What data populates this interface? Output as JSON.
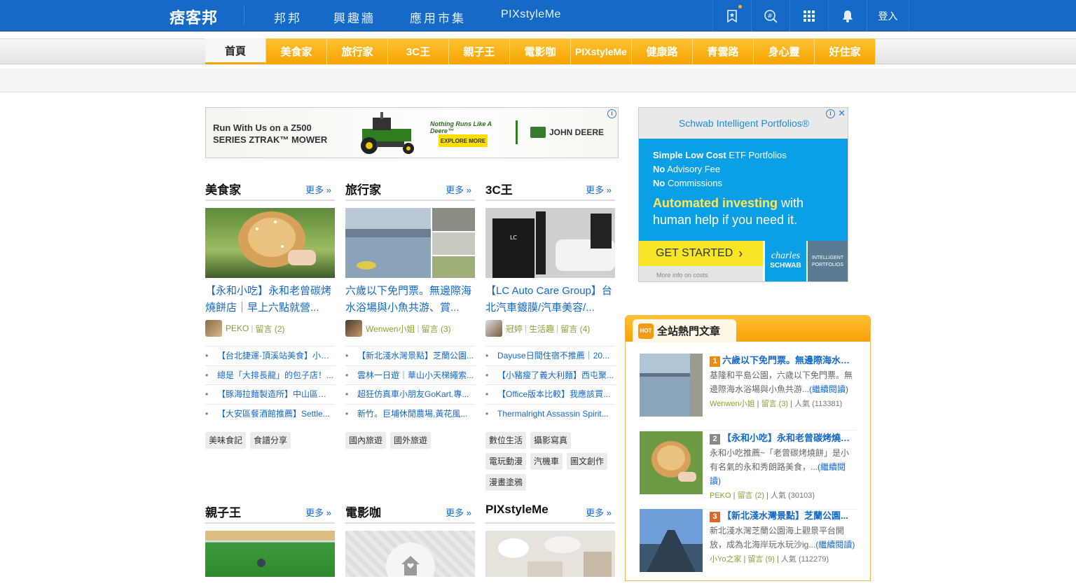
{
  "topbar": {
    "logo": "痞客邦",
    "nav": [
      "邦邦",
      "興趣牆",
      "應用市集",
      "PIXstyleMe"
    ],
    "icons": [
      "bookmark-star-icon",
      "search-hash-icon",
      "apps-grid-icon",
      "bell-icon"
    ],
    "login": "登入"
  },
  "categories": [
    "首頁",
    "美食家",
    "旅行家",
    "3C王",
    "親子王",
    "電影咖",
    "PIXstyleMe",
    "健康路",
    "青雲路",
    "身心靈",
    "好住家"
  ],
  "ad_banner": {
    "headline": "Run With Us on a Z500 SERIES ZTRAK™ MOWER",
    "tagline": "Nothing Runs Like A Deere™",
    "button": "EXPLORE MORE",
    "brand": "JOHN DEERE"
  },
  "ad_side": {
    "title": "Schwab Intelligent Portfolios®",
    "lines": [
      {
        "bold": "Simple Low Cost",
        "rest": " ETF Portfolios"
      },
      {
        "bold": "No",
        "rest": " Advisory Fee"
      },
      {
        "bold": "No",
        "rest": " Commissions"
      }
    ],
    "auto_bold": "Automated investing",
    "auto_rest": " with human help if you need it.",
    "button": "GET STARTED",
    "brand1": "charles",
    "brand2": "SCHWAB",
    "brand_box": "INTELLIGENT PORTFOLIOS",
    "footer": "More info on costs"
  },
  "sections": [
    {
      "title": "美食家",
      "more": "更多 »",
      "post_title": "【永和小吃】永和老曾碳烤燒餅店｜早上六點就營...",
      "author": "PEKO",
      "comments": "留言 (2)",
      "category": "",
      "list": [
        "【台北捷運-頂溪站美食】小吃...",
        "總是「大排長龍」的包子店！...",
        "【豚海拉麵製造所】中山區拉麵...",
        "【大安區餐酒館推薦】Settle..."
      ],
      "tags": [
        "美味食記",
        "食譜分享"
      ]
    },
    {
      "title": "旅行家",
      "more": "更多 »",
      "post_title": "六歲以下免門票。無邊際海水浴場與小魚共游、賞...",
      "author": "Wenwen小姐",
      "comments": "留言 (3)",
      "category": "",
      "list": [
        "【新北淺水灣景點】芝蘭公園...",
        "雲林一日遊｜華山小天梯繩索...",
        "超狂仿真車小朋友GoKart.專...",
        "新竹。巨埔休閒農場,黃花風..."
      ],
      "tags": [
        "國內旅遊",
        "國外旅遊"
      ]
    },
    {
      "title": "3C王",
      "more": "更多 »",
      "post_title": "【LC Auto Care Group】台北汽車鍍膜/汽車美容/...",
      "author": "冠婷",
      "comments": "留言 (4)",
      "category": "生活趣",
      "list": [
        "Dayuse日間住宿不推薦｜20...",
        "【小豬瘦了義大利麵】西屯聚...",
        "【Office版本比較】我應該買...",
        "Thermalright Assassin Spirit..."
      ],
      "tags": [
        "數位生活",
        "攝影寫真",
        "電玩動漫",
        "汽機車",
        "圖文創作",
        "漫畫塗鴉"
      ]
    },
    {
      "title": "親子王",
      "more": "更多 »"
    },
    {
      "title": "電影咖",
      "more": "更多 »"
    },
    {
      "title": "PIXstyleMe",
      "more": "更多 »"
    }
  ],
  "hot": {
    "title": "全站熱門文章",
    "read_more": "(繼續閱讀)",
    "items": [
      {
        "rank": "1",
        "rank_color": "#f08a00",
        "title": "六歲以下免門票。無邊際海水浴...",
        "summary": "基隆和平島公園，六歲以下免門票。無邊際海水浴場與小魚共游...",
        "author": "Wenwen小姐",
        "comments": "留言 (3)",
        "views": "人氣 (113381)"
      },
      {
        "rank": "2",
        "rank_color": "#888888",
        "title": "【永和小吃】永和老曾碳烤燒餅...",
        "summary": "永和小吃推薦~「老曾碳烤燒餅」是小有名氣的永和秀朗路美食，...",
        "author": "PEKO",
        "comments": "留言 (2)",
        "views": "人氣 (30103)"
      },
      {
        "rank": "3",
        "rank_color": "#e0662a",
        "title": "【新北淺水灣景點】芝蘭公園...",
        "summary": "新北淺水灣芝蘭公園海上觀景平台開放，成為北海岸玩水玩沙ig...",
        "author": "小Yo之家",
        "comments": "留言 (9)",
        "views": "人氣 (112279)"
      }
    ]
  }
}
